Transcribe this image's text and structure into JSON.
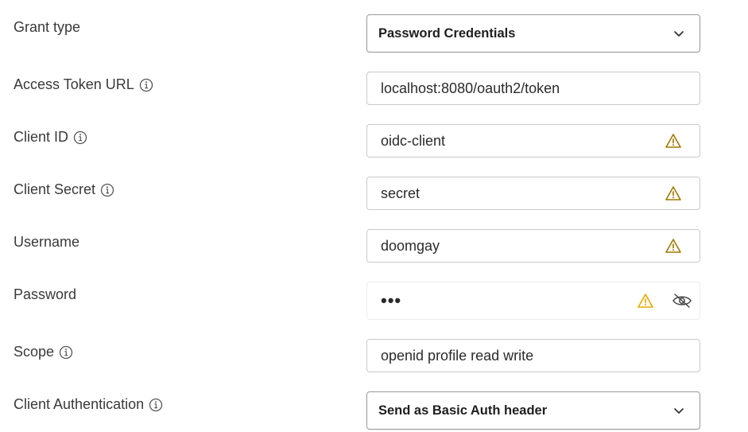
{
  "form": {
    "grant_type": {
      "label": "Grant type",
      "value": "Password Credentials"
    },
    "access_token_url": {
      "label": "Access Token URL",
      "value": "localhost:8080/oauth2/token"
    },
    "client_id": {
      "label": "Client ID",
      "value": "oidc-client"
    },
    "client_secret": {
      "label": "Client Secret",
      "value": "secret"
    },
    "username": {
      "label": "Username",
      "value": "doomgay"
    },
    "password": {
      "label": "Password",
      "value": "•••"
    },
    "scope": {
      "label": "Scope",
      "value": "openid profile read write"
    },
    "client_authentication": {
      "label": "Client Authentication",
      "value": "Send as Basic Auth header"
    }
  },
  "icons": {
    "info": "info-circle-icon",
    "warning": "warning-triangle-icon",
    "eye": "eye-slash-icon",
    "chevron": "chevron-down-icon"
  },
  "colors": {
    "warning_dark": "#a07800",
    "warning_light": "#e6a800",
    "border": "#c9c9c9",
    "label_text": "#3a3a3a"
  }
}
